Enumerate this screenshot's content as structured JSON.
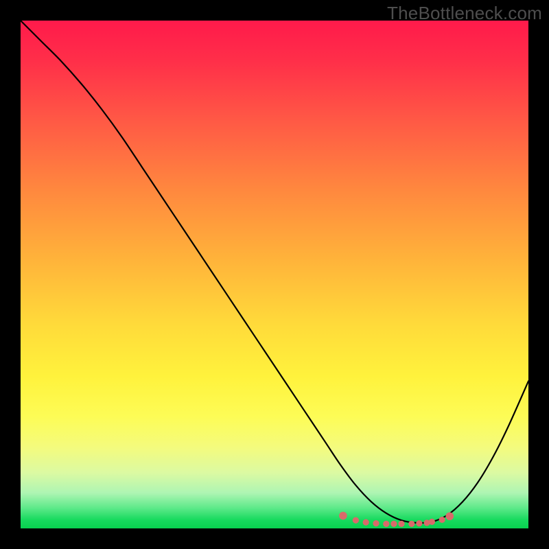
{
  "watermark": "TheBottleneck.com",
  "colors": {
    "page_bg": "#000000",
    "watermark_text": "#4e4e4e",
    "curve_stroke": "#000000",
    "marker_stroke": "#d96a6a",
    "marker_fill": "#d96a6a",
    "gradient_top": "#ff1a4b",
    "gradient_bottom": "#08d14f"
  },
  "chart_data": {
    "type": "line",
    "title": "",
    "xlabel": "",
    "ylabel": "",
    "xlim": [
      0,
      100
    ],
    "ylim": [
      0,
      100
    ],
    "series": [
      {
        "name": "bottleneck-curve",
        "x": [
          0,
          4,
          8,
          12,
          16,
          20,
          24,
          28,
          32,
          36,
          40,
          44,
          48,
          52,
          56,
          60,
          63,
          66,
          69,
          72,
          75,
          78,
          81,
          84,
          87,
          90,
          93,
          96,
          100
        ],
        "values": [
          100,
          96,
          92,
          87.5,
          82.5,
          77,
          71,
          65,
          59,
          53,
          47,
          41,
          35,
          29,
          23,
          17,
          12.5,
          8.5,
          5.3,
          3,
          1.6,
          1.1,
          1.3,
          2.6,
          5.2,
          9,
          14,
          20,
          29
        ]
      }
    ],
    "annotations": [
      {
        "name": "optimal-range-markers",
        "type": "scatter",
        "x": [
          63.5,
          66,
          68,
          70,
          72,
          73.5,
          75,
          77,
          78.5,
          80,
          81,
          83,
          84.5
        ],
        "values": [
          2.5,
          1.6,
          1.2,
          1.0,
          0.9,
          0.9,
          0.9,
          0.9,
          1.0,
          1.1,
          1.3,
          1.7,
          2.4
        ]
      }
    ]
  }
}
